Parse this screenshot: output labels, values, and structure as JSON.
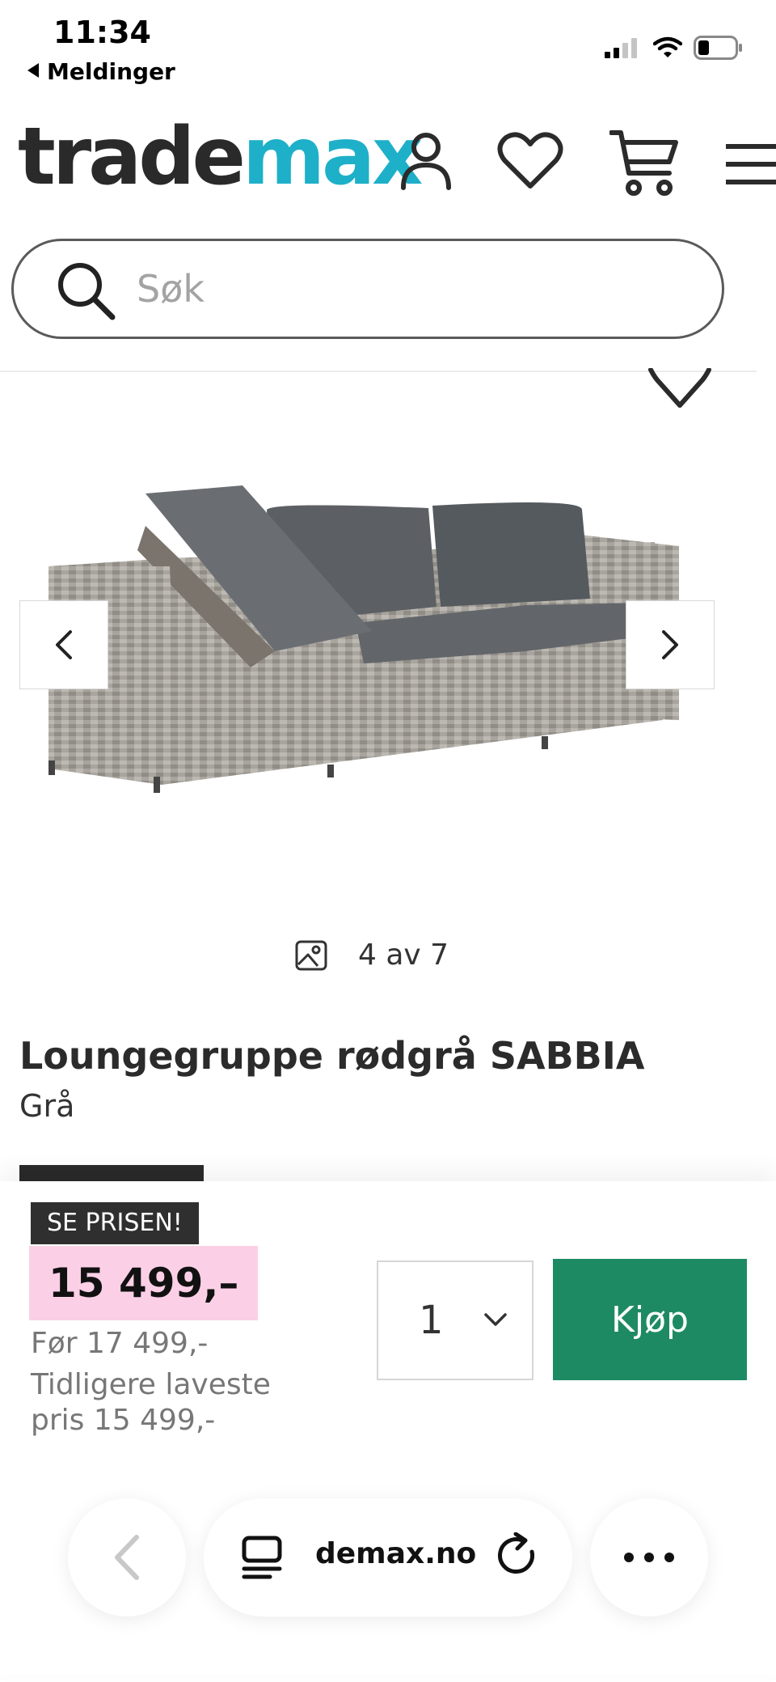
{
  "status_bar": {
    "time": "11:34",
    "back_label": "Meldinger"
  },
  "header": {
    "logo_part1": "trade",
    "logo_part2": "max"
  },
  "search": {
    "placeholder": "Søk"
  },
  "gallery": {
    "counter": "4 av 7"
  },
  "product": {
    "title": "Loungegruppe rødgrå SABBIA",
    "color": "Grå"
  },
  "pricing": {
    "badge": "SE PRISEN!",
    "price": "15 499,–",
    "before": "Før 17 499,-",
    "lowest": "Tidligere laveste pris 15 499,-",
    "quantity": "1",
    "buy_label": "Kjøp"
  },
  "browser": {
    "url": "demax.no"
  },
  "colors": {
    "brand_teal": "#1eb0c8",
    "buy_green": "#1e8a64",
    "price_pink": "#fbd0e6"
  },
  "icons": [
    "user-icon",
    "heart-icon",
    "cart-icon",
    "menu-icon",
    "search-icon",
    "chevron-left-icon",
    "chevron-right-icon",
    "image-icon",
    "chevron-down-icon",
    "reader-icon",
    "reload-icon",
    "more-icon"
  ]
}
